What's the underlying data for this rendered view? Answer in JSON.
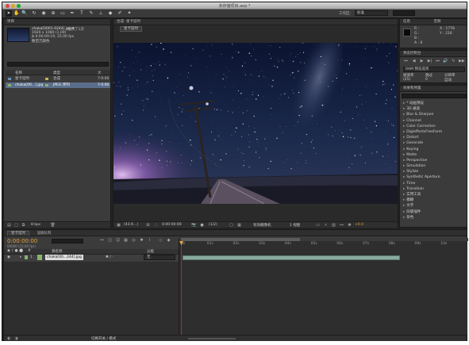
{
  "window": {
    "title": "未存储项目.aep *"
  },
  "toolbar": {
    "workspace_label": "工作区:",
    "workspace_value": "标准"
  },
  "project": {
    "tab": "项目",
    "file_name": "chaka[0001-0244].jpg ▾",
    "used_text": "使用了1次",
    "resolution": "1920 x 1080 (1.00)",
    "duration": "Δ 0:00:09:19, 25.00 fps",
    "colors": "数百万颜色",
    "col_name": "名称",
    "col_type": "类型",
    "col_size": "大",
    "items": [
      {
        "name": "星卡延时",
        "type": "合成",
        "size": "7·0:00",
        "color": "#c4b25a"
      },
      {
        "name": "chaka[00...].jpg",
        "type": "JPEG 序列",
        "size": "7·0:00",
        "color": "#8ab26b"
      }
    ],
    "bpc": "8 bpc"
  },
  "composition": {
    "tab": "合成: 星卡延时",
    "subtab": "星卡延时",
    "zoom": "(43.9…)",
    "timecode": "0:00:00:00",
    "resolution": "(1/2)",
    "camera": "有效摄像机",
    "views": "1 视图",
    "exposure": "+0.0"
  },
  "info": {
    "tab": "信息",
    "tab2": "音频",
    "r": "R :",
    "g": "G :",
    "b": "B :",
    "a": "A : 0",
    "x": "X : 1778",
    "y": "Y : 216"
  },
  "preview": {
    "tab": "预览控制台",
    "mode": "RAM 预览选项",
    "fps_label": "帧速率",
    "skip_label": "跳过",
    "res_label": "分辨率",
    "fps_value": "(25)",
    "skip_value": "0",
    "res_value": "自动"
  },
  "effects": {
    "tab": "效果和预置",
    "items": [
      "* 动画预设",
      "3D 通道",
      "Blur & Sharpen",
      "Channel",
      "Color Correction",
      "DigieffectsFreeForm",
      "Distort",
      "Generate",
      "Keying",
      "Matte",
      "Perspective",
      "Simulation",
      "Stylize",
      "Synthetic Aperture",
      "Time",
      "Transition",
      "实用工具",
      "模糊",
      "文字",
      "旧版插件",
      "杂色"
    ]
  },
  "timeline": {
    "tab": "星卡延时",
    "tab2": "渲染队列",
    "timecode": "0:00:00:00",
    "frames": "00000 (25.00 fps)",
    "col_num": "#",
    "col_source": "源名称",
    "col_parent": "父级",
    "layer_num": "1",
    "layer_name": "chaka[00...244].jpg",
    "layer_parent": "无",
    "ruler": [
      "0s",
      "01s",
      "02s",
      "03s",
      "04s",
      "05s",
      "06s",
      "07s",
      "08s",
      "09s",
      "10s"
    ],
    "toggle_label": "切换开关 / 模式"
  }
}
